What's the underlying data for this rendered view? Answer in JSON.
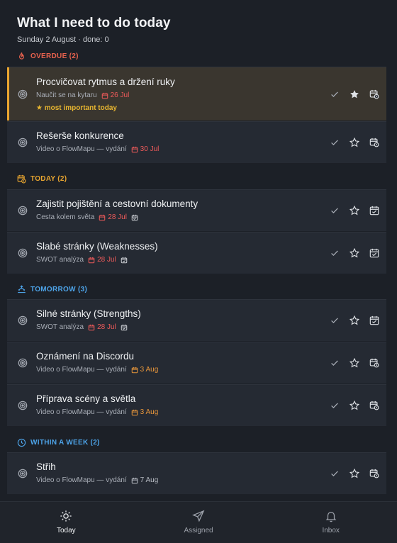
{
  "header": {
    "title": "What I need to do today",
    "subtitle": "Sunday 2 August · done: 0"
  },
  "sections": {
    "overdue": {
      "label": "OVERDUE (2)",
      "color": "#e8624e"
    },
    "today": {
      "label": "TODAY (2)",
      "color": "#e8a530"
    },
    "tomorrow": {
      "label": "TOMORROW (3)",
      "color": "#4da3e8"
    },
    "week": {
      "label": "WITHIN A WEEK (2)",
      "color": "#4da3e8"
    }
  },
  "tasks": [
    {
      "title": "Procvičovat rytmus a držení ruky",
      "project": "Naučit se na kytaru",
      "date": "26 Jul",
      "important": "★ most important today",
      "starred": true
    },
    {
      "title": "Rešerše konkurence",
      "project": "Video o FlowMapu — vydání",
      "date": "30 Jul"
    },
    {
      "title": "Zajistit pojištění a cestovní dokumenty",
      "project": "Cesta kolem světa",
      "date": "28 Jul"
    },
    {
      "title": "Slabé stránky (Weaknesses)",
      "project": "SWOT analýza",
      "date": "28 Jul"
    },
    {
      "title": "Silné stránky (Strengths)",
      "project": "SWOT analýza",
      "date": "28 Jul"
    },
    {
      "title": "Oznámení na Discordu",
      "project": "Video o FlowMapu — vydání",
      "date": "3 Aug"
    },
    {
      "title": "Příprava scény a světla",
      "project": "Video o FlowMapu — vydání",
      "date": "3 Aug"
    },
    {
      "title": "Střih",
      "project": "Video o FlowMapu — vydání",
      "date": "7 Aug"
    }
  ],
  "nav": {
    "today": "Today",
    "assigned": "Assigned",
    "inbox": "Inbox"
  }
}
